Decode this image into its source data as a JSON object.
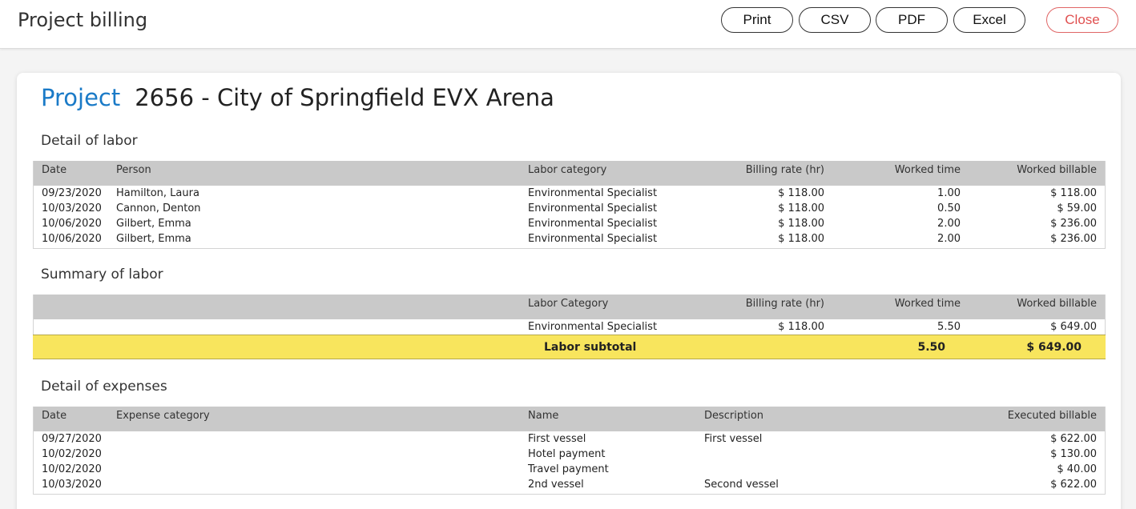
{
  "header": {
    "title": "Project billing",
    "buttons": {
      "print": "Print",
      "csv": "CSV",
      "pdf": "PDF",
      "excel": "Excel",
      "close": "Close"
    }
  },
  "project": {
    "label": "Project",
    "name": "2656 - City of Springfield EVX Arena"
  },
  "detail_of_labor": {
    "title": "Detail of labor",
    "columns": [
      "Date",
      "Person",
      "Labor category",
      "Billing rate (hr)",
      "Worked time",
      "Worked billable"
    ],
    "rows": [
      [
        "09/23/2020",
        "Hamilton, Laura",
        "Environmental Specialist",
        "$ 118.00",
        "1.00",
        "$ 118.00"
      ],
      [
        "10/03/2020",
        "Cannon, Denton",
        "Environmental Specialist",
        "$ 118.00",
        "0.50",
        "$ 59.00"
      ],
      [
        "10/06/2020",
        "Gilbert, Emma",
        "Environmental Specialist",
        "$ 118.00",
        "2.00",
        "$ 236.00"
      ],
      [
        "10/06/2020",
        "Gilbert, Emma",
        "Environmental Specialist",
        "$ 118.00",
        "2.00",
        "$ 236.00"
      ]
    ]
  },
  "summary_of_labor": {
    "title": "Summary of labor",
    "columns": [
      "Labor Category",
      "Billing rate (hr)",
      "Worked time",
      "Worked billable"
    ],
    "rows": [
      [
        "Environmental Specialist",
        "$ 118.00",
        "5.50",
        "$ 649.00"
      ]
    ],
    "subtotal": {
      "label": "Labor subtotal",
      "time": "5.50",
      "billable": "$ 649.00"
    }
  },
  "detail_of_expenses": {
    "title": "Detail of expenses",
    "columns": [
      "Date",
      "Expense category",
      "Name",
      "Description",
      "Executed billable"
    ],
    "rows": [
      [
        "09/27/2020",
        "",
        "First vessel",
        "First vessel",
        "$ 622.00"
      ],
      [
        "10/02/2020",
        "",
        "Hotel payment",
        "",
        "$ 130.00"
      ],
      [
        "10/02/2020",
        "",
        "Travel payment",
        "",
        "$ 40.00"
      ],
      [
        "10/03/2020",
        "",
        "2nd vessel",
        "Second vessel",
        "$ 622.00"
      ]
    ]
  }
}
